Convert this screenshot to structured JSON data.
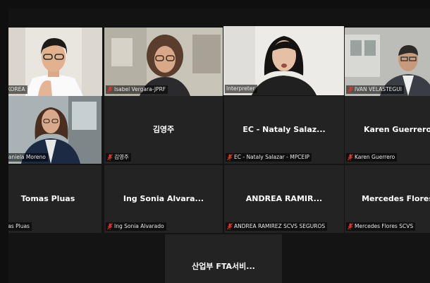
{
  "colors": {
    "active_speaker": "#c9e35a",
    "muted_mic": "#e0352b",
    "tile_bg": "#232323"
  },
  "icons": {
    "muted": "muted-mic-icon"
  },
  "tiles": [
    {
      "label": "KOREA",
      "muted": false
    },
    {
      "label": "Isabel Vergara-JPRF",
      "muted": true
    },
    {
      "label": "Interpreter",
      "muted": false
    },
    {
      "label": "IVAN VELASTEGUI",
      "muted": true
    },
    {
      "label": "Daniela Moreno",
      "muted": false
    },
    {
      "name": "김영주",
      "label": "김영주",
      "muted": true
    },
    {
      "name": "EC - Nataly Salaz...",
      "label": "EC - Nataly Salazar - MPCEIP",
      "muted": true
    },
    {
      "name": "Karen Guerrero",
      "label": "Karen Guerrero",
      "muted": true
    },
    {
      "name": "Tomas Pluas",
      "label": "Tomas Pluas",
      "muted": false
    },
    {
      "name": "Ing Sonia Alvara...",
      "label": "Ing Sonia Alvarado",
      "muted": true
    },
    {
      "name": "ANDREA RAMIR...",
      "label": "ANDREA RAMIREZ SCVS SEGUROS",
      "muted": true
    },
    {
      "name": "Mercedes Flores",
      "label": "Mercedes Flores SCVS",
      "muted": true
    },
    {
      "name": "산업부 FTA서비..."
    }
  ]
}
